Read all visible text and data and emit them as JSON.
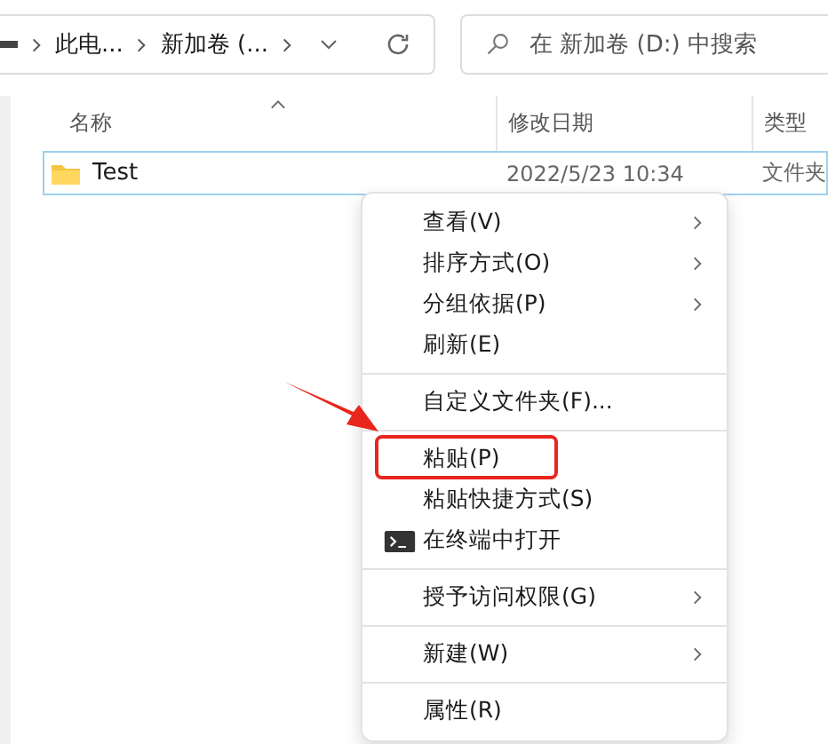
{
  "address_bar": {
    "crumbs": [
      "此电...",
      "新加卷 (..."
    ]
  },
  "search": {
    "placeholder": "在 新加卷 (D:) 中搜索"
  },
  "columns": [
    {
      "label": "名称",
      "sorted": true
    },
    {
      "label": "修改日期",
      "sorted": false
    },
    {
      "label": "类型",
      "sorted": false
    }
  ],
  "rows": [
    {
      "name": "Test",
      "modified": "2022/5/23 10:34",
      "type": "文件夹",
      "selected": true
    }
  ],
  "context_menu": [
    {
      "kind": "item",
      "label": "查看(V)",
      "submenu": true
    },
    {
      "kind": "item",
      "label": "排序方式(O)",
      "submenu": true
    },
    {
      "kind": "item",
      "label": "分组依据(P)",
      "submenu": true
    },
    {
      "kind": "item",
      "label": "刷新(E)",
      "submenu": false
    },
    {
      "kind": "separator"
    },
    {
      "kind": "item",
      "label": "自定义文件夹(F)...",
      "submenu": false
    },
    {
      "kind": "separator"
    },
    {
      "kind": "item",
      "label": "粘贴(P)",
      "submenu": false,
      "highlighted": true
    },
    {
      "kind": "item",
      "label": "粘贴快捷方式(S)",
      "submenu": false
    },
    {
      "kind": "terminal",
      "label": "在终端中打开",
      "submenu": false
    },
    {
      "kind": "separator"
    },
    {
      "kind": "item",
      "label": "授予访问权限(G)",
      "submenu": true
    },
    {
      "kind": "separator"
    },
    {
      "kind": "item",
      "label": "新建(W)",
      "submenu": true
    },
    {
      "kind": "separator"
    },
    {
      "kind": "item",
      "label": "属性(R)",
      "submenu": false
    }
  ],
  "annotation": {
    "arrow": true
  }
}
